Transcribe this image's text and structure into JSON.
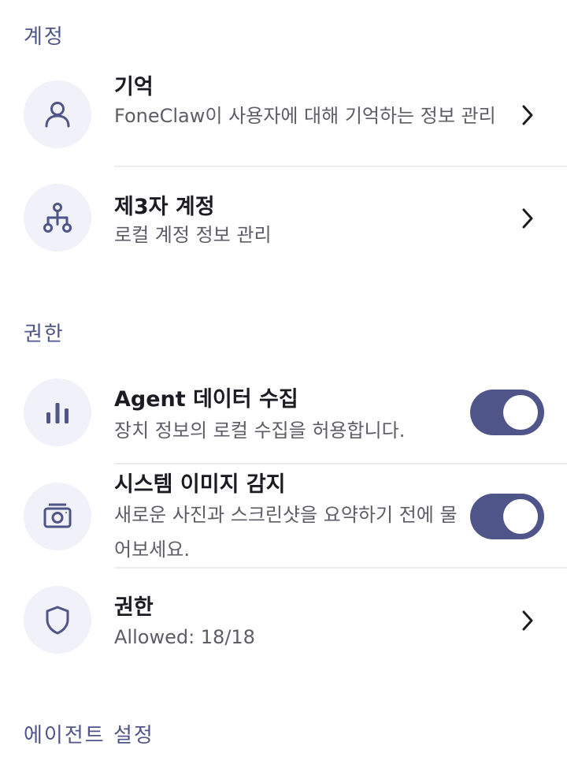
{
  "sections": {
    "account": "계정",
    "permissions": "권한",
    "agent_settings": "에이전트 설정"
  },
  "rows": {
    "memory": {
      "title": "기억",
      "subtitle": "FoneClaw이 사용자에 대해 기억하는 정보 관리",
      "icon": "person-icon"
    },
    "third_party": {
      "title": "제3자 계정",
      "subtitle": "로컬 계정 정보 관리",
      "icon": "hierarchy-icon"
    },
    "agent_data": {
      "title": "Agent 데이터 수집",
      "subtitle": "장치 정보의 로컬 수집을 허용합니다.",
      "icon": "bar-chart-icon",
      "enabled": true
    },
    "system_image": {
      "title": "시스템 이미지 감지",
      "subtitle": "새로운 사진과 스크린샷을 요약하기 전에 물어보세요.",
      "icon": "camera-icon",
      "enabled": true
    },
    "permissions": {
      "title": "권한",
      "subtitle": "Allowed: 18/18",
      "icon": "shield-icon"
    }
  },
  "colors": {
    "accent": "#4f5489",
    "icon_bg": "#f0f1f9",
    "divider": "#ececf1"
  }
}
